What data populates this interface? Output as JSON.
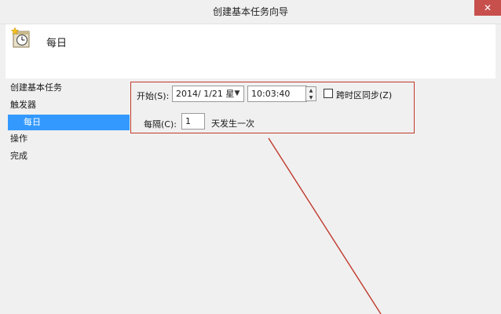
{
  "window": {
    "title": "创建基本任务向导",
    "close_glyph": "✕"
  },
  "header": {
    "title": "每日",
    "icon": "calendar-clock-icon"
  },
  "nav": {
    "items": [
      {
        "label": "创建基本任务",
        "selected": false
      },
      {
        "label": "触发器",
        "selected": false
      },
      {
        "label": "每日",
        "selected": true
      },
      {
        "label": "操作",
        "selected": false
      },
      {
        "label": "完成",
        "selected": false
      }
    ]
  },
  "trigger": {
    "start_label": "开始(S):",
    "start_date": "2014/ 1/21 星",
    "start_time": "10:03:40",
    "sync_timezone_label": "跨时区同步(Z)",
    "sync_timezone_checked": false,
    "interval_label": "每隔(C):",
    "interval_value": "1",
    "interval_suffix": "天发生一次"
  },
  "colors": {
    "selection": "#3399ff",
    "annotation": "#c0392b",
    "close": "#c7504d"
  }
}
